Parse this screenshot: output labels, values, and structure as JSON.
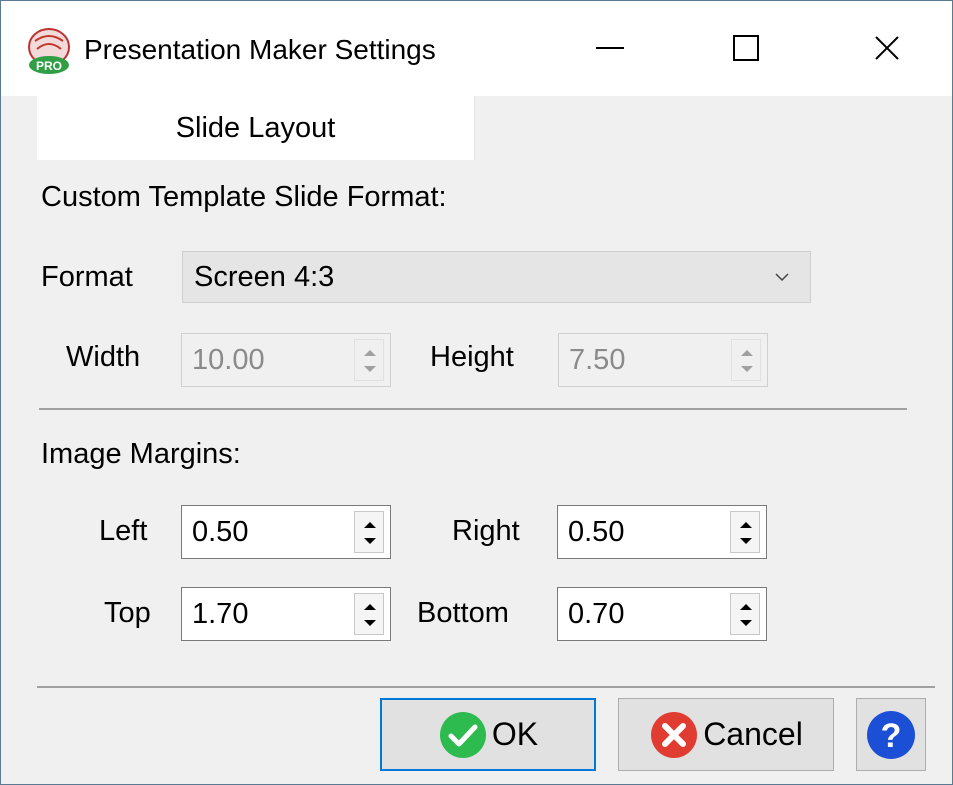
{
  "window": {
    "title": "Presentation Maker Settings",
    "icon": "presentation-maker-pro-icon",
    "controls": [
      "minimize-icon",
      "maximize-icon",
      "close-icon"
    ]
  },
  "tabs": [
    {
      "label": "Slide Layout",
      "selected": true
    }
  ],
  "slide_format": {
    "heading": "Custom Template Slide Format:",
    "format_label": "Format",
    "format_value": "Screen 4:3",
    "width_label": "Width",
    "width_value": "10.00",
    "height_label": "Height",
    "height_value": "7.50"
  },
  "margins": {
    "heading": "Image Margins:",
    "left_label": "Left",
    "left_value": "0.50",
    "right_label": "Right",
    "right_value": "0.50",
    "top_label": "Top",
    "top_value": "1.70",
    "bottom_label": "Bottom",
    "bottom_value": "0.70"
  },
  "buttons": {
    "ok_label": "OK",
    "cancel_label": "Cancel"
  },
  "colors": {
    "ok_icon": "#2dbb4f",
    "cancel_icon": "#e03c31",
    "help_icon": "#1a4fd6",
    "focus_border": "#0078d7"
  }
}
